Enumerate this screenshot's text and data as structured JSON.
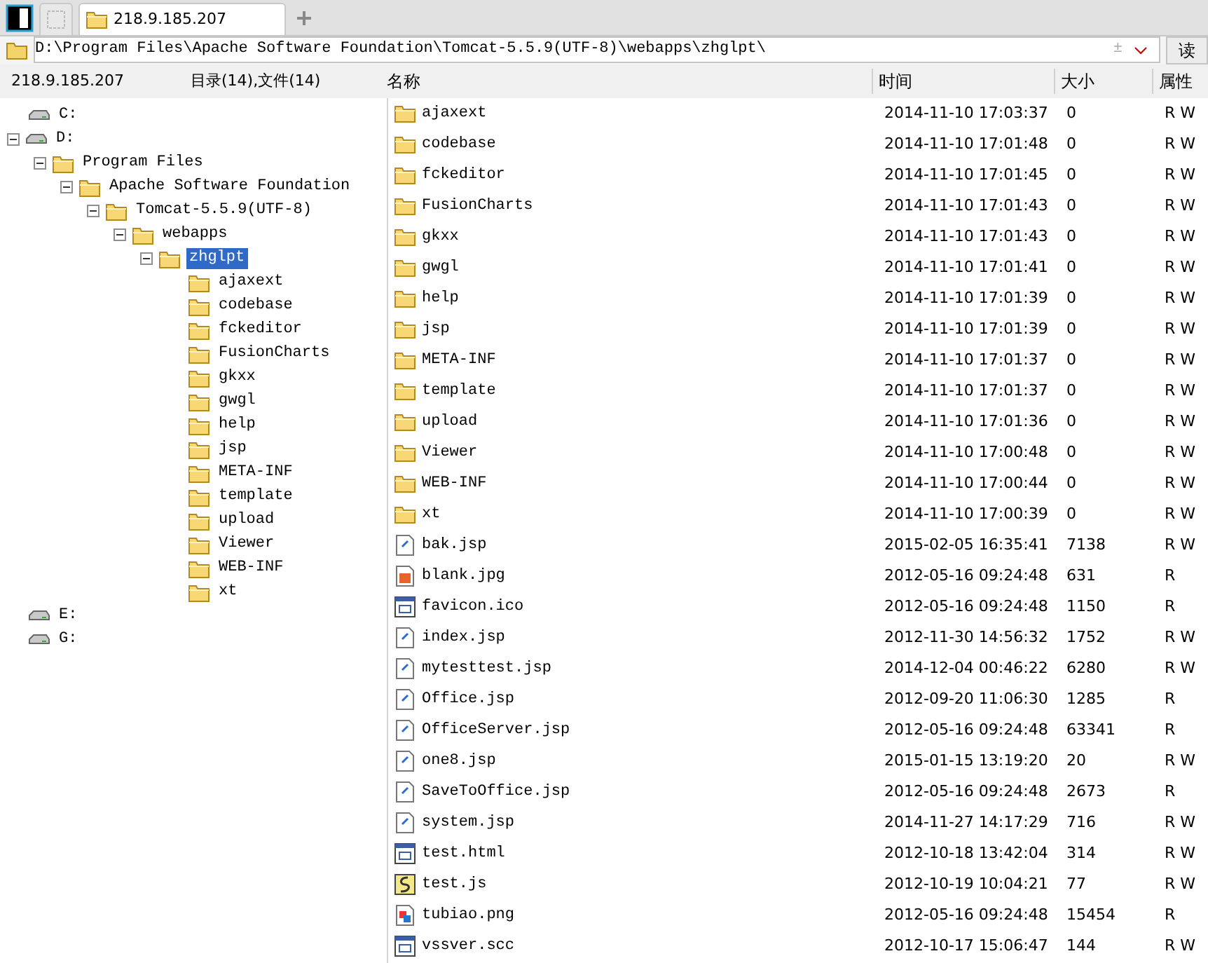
{
  "tabs": [
    {
      "label": "218.9.185.207",
      "selected": true
    }
  ],
  "address": {
    "value": "D:\\Program Files\\Apache Software Foundation\\Tomcat-5.5.9(UTF-8)\\webapps\\zhglpt\\",
    "plus": "±",
    "button": "读"
  },
  "info": {
    "host": "218.9.185.207",
    "counts": "目录(14),文件(14)"
  },
  "columns": [
    "名称",
    "时间",
    "大小",
    "属性"
  ],
  "tree": [
    {
      "label": "C:",
      "kind": "drive",
      "selected": false
    },
    {
      "label": "D:",
      "kind": "drive",
      "selected": false,
      "expanded": true,
      "children": [
        {
          "label": "Program Files",
          "kind": "folder",
          "selected": false,
          "expanded": true,
          "children": [
            {
              "label": "Apache Software Foundation",
              "kind": "folder",
              "selected": false,
              "expanded": true,
              "children": [
                {
                  "label": "Tomcat-5.5.9(UTF-8)",
                  "kind": "folder",
                  "selected": false,
                  "expanded": true,
                  "children": [
                    {
                      "label": "webapps",
                      "kind": "folder",
                      "selected": false,
                      "expanded": true,
                      "children": [
                        {
                          "label": "zhglpt",
                          "kind": "folder",
                          "selected": true,
                          "expanded": true,
                          "children": [
                            {
                              "label": "ajaxext",
                              "kind": "folder",
                              "selected": false
                            },
                            {
                              "label": "codebase",
                              "kind": "folder",
                              "selected": false
                            },
                            {
                              "label": "fckeditor",
                              "kind": "folder",
                              "selected": false
                            },
                            {
                              "label": "FusionCharts",
                              "kind": "folder",
                              "selected": false
                            },
                            {
                              "label": "gkxx",
                              "kind": "folder",
                              "selected": false
                            },
                            {
                              "label": "gwgl",
                              "kind": "folder",
                              "selected": false
                            },
                            {
                              "label": "help",
                              "kind": "folder",
                              "selected": false
                            },
                            {
                              "label": "jsp",
                              "kind": "folder",
                              "selected": false
                            },
                            {
                              "label": "META-INF",
                              "kind": "folder",
                              "selected": false
                            },
                            {
                              "label": "template",
                              "kind": "folder",
                              "selected": false
                            },
                            {
                              "label": "upload",
                              "kind": "folder",
                              "selected": false
                            },
                            {
                              "label": "Viewer",
                              "kind": "folder",
                              "selected": false
                            },
                            {
                              "label": "WEB-INF",
                              "kind": "folder",
                              "selected": false
                            },
                            {
                              "label": "xt",
                              "kind": "folder",
                              "selected": false
                            }
                          ]
                        }
                      ]
                    }
                  ]
                }
              ]
            }
          ]
        }
      ]
    },
    {
      "label": "E:",
      "kind": "drive",
      "selected": false
    },
    {
      "label": "G:",
      "kind": "drive",
      "selected": false
    }
  ],
  "files": [
    {
      "name": "ajaxext",
      "kind": "folder",
      "time": "2014-11-10 17:03:37",
      "size": "0",
      "attr": "R W"
    },
    {
      "name": "codebase",
      "kind": "folder",
      "time": "2014-11-10 17:01:48",
      "size": "0",
      "attr": "R W"
    },
    {
      "name": "fckeditor",
      "kind": "folder",
      "time": "2014-11-10 17:01:45",
      "size": "0",
      "attr": "R W"
    },
    {
      "name": "FusionCharts",
      "kind": "folder",
      "time": "2014-11-10 17:01:43",
      "size": "0",
      "attr": "R W"
    },
    {
      "name": "gkxx",
      "kind": "folder",
      "time": "2014-11-10 17:01:43",
      "size": "0",
      "attr": "R W"
    },
    {
      "name": "gwgl",
      "kind": "folder",
      "time": "2014-11-10 17:01:41",
      "size": "0",
      "attr": "R W"
    },
    {
      "name": "help",
      "kind": "folder",
      "time": "2014-11-10 17:01:39",
      "size": "0",
      "attr": "R W"
    },
    {
      "name": "jsp",
      "kind": "folder",
      "time": "2014-11-10 17:01:39",
      "size": "0",
      "attr": "R W"
    },
    {
      "name": "META-INF",
      "kind": "folder",
      "time": "2014-11-10 17:01:37",
      "size": "0",
      "attr": "R W"
    },
    {
      "name": "template",
      "kind": "folder",
      "time": "2014-11-10 17:01:37",
      "size": "0",
      "attr": "R W"
    },
    {
      "name": "upload",
      "kind": "folder",
      "time": "2014-11-10 17:01:36",
      "size": "0",
      "attr": "R W"
    },
    {
      "name": "Viewer",
      "kind": "folder",
      "time": "2014-11-10 17:00:48",
      "size": "0",
      "attr": "R W"
    },
    {
      "name": "WEB-INF",
      "kind": "folder",
      "time": "2014-11-10 17:00:44",
      "size": "0",
      "attr": "R W"
    },
    {
      "name": "xt",
      "kind": "folder",
      "time": "2014-11-10 17:00:39",
      "size": "0",
      "attr": "R W"
    },
    {
      "name": "bak.jsp",
      "kind": "doc",
      "time": "2015-02-05 16:35:41",
      "size": "7138",
      "attr": "R W"
    },
    {
      "name": "blank.jpg",
      "kind": "image",
      "time": "2012-05-16 09:24:48",
      "size": "631",
      "attr": "R"
    },
    {
      "name": "favicon.ico",
      "kind": "window",
      "time": "2012-05-16 09:24:48",
      "size": "1150",
      "attr": "R"
    },
    {
      "name": "index.jsp",
      "kind": "doc",
      "time": "2012-11-30 14:56:32",
      "size": "1752",
      "attr": "R W"
    },
    {
      "name": "mytesttest.jsp",
      "kind": "doc",
      "time": "2014-12-04 00:46:22",
      "size": "6280",
      "attr": "R W"
    },
    {
      "name": "Office.jsp",
      "kind": "doc",
      "time": "2012-09-20 11:06:30",
      "size": "1285",
      "attr": "R"
    },
    {
      "name": "OfficeServer.jsp",
      "kind": "doc",
      "time": "2012-05-16 09:24:48",
      "size": "63341",
      "attr": "R"
    },
    {
      "name": "one8.jsp",
      "kind": "doc",
      "time": "2015-01-15 13:19:20",
      "size": "20",
      "attr": "R W"
    },
    {
      "name": "SaveToOffice.jsp",
      "kind": "doc",
      "time": "2012-05-16 09:24:48",
      "size": "2673",
      "attr": "R"
    },
    {
      "name": "system.jsp",
      "kind": "doc",
      "time": "2014-11-27 14:17:29",
      "size": "716",
      "attr": "R W"
    },
    {
      "name": "test.html",
      "kind": "window",
      "time": "2012-10-18 13:42:04",
      "size": "314",
      "attr": "R W"
    },
    {
      "name": "test.js",
      "kind": "script",
      "time": "2012-10-19 10:04:21",
      "size": "77",
      "attr": "R W"
    },
    {
      "name": "tubiao.png",
      "kind": "picture-file",
      "time": "2012-05-16 09:24:48",
      "size": "15454",
      "attr": "R"
    },
    {
      "name": "vssver.scc",
      "kind": "window",
      "time": "2012-10-17 15:06:47",
      "size": "144",
      "attr": "R W"
    }
  ]
}
